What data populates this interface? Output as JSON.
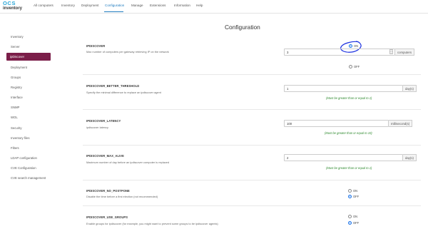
{
  "logo": {
    "line1": "OCS",
    "line2": "inventory"
  },
  "nav": {
    "all_computers": "All computers",
    "inventory": "Inventory",
    "deployment": "Deployment",
    "configuration": "Configuration",
    "manage": "Manage",
    "extensions": "Extensions",
    "information": "Information",
    "help": "Help"
  },
  "page": {
    "title": "Configuration"
  },
  "sidebar": {
    "items": [
      {
        "label": "Inventory"
      },
      {
        "label": "Server"
      },
      {
        "label": "ipDiscover"
      },
      {
        "label": "Deployment"
      },
      {
        "label": "Groups"
      },
      {
        "label": "Registry"
      },
      {
        "label": "Interface"
      },
      {
        "label": "SNMP"
      },
      {
        "label": "WOL"
      },
      {
        "label": "Security"
      },
      {
        "label": "Inventory files"
      },
      {
        "label": "Filters"
      },
      {
        "label": "LDAP configuration"
      },
      {
        "label": "CVE Configuration"
      },
      {
        "label": "CVE search management"
      }
    ]
  },
  "settings": {
    "ipdiscover": {
      "name": "IPDISCOVER",
      "desc": "Max number of computers per gateway retrieving IP on the network",
      "on_label": "ON",
      "off_label": "OFF",
      "value": "3",
      "unit": "computers",
      "selected": "ON"
    },
    "better_threshold": {
      "name": "IPDISCOVER_BETTER_THRESHOLD",
      "desc": "Specify the minimal difference to replace an ipdiscover agent",
      "value": "1",
      "unit": "day(s)",
      "hint": "(Must be greater than or equal to 1)"
    },
    "latency": {
      "name": "IPDISCOVER_LATENCY",
      "desc": "ipdiscover latency",
      "value": "100",
      "unit": "millisecond(s)",
      "hint": "(Must be greater than or equal to 10)"
    },
    "max_alive": {
      "name": "IPDISCOVER_MAX_ALIVE",
      "desc": "Maximum number of day before an ipdiscover computer is replaced",
      "value": "2",
      "unit": "day(s)",
      "hint": "(Must be greater than or equal to 1)"
    },
    "no_postpone": {
      "name": "IPDISCOVER_NO_POSTPONE",
      "desc": "Disable the time before a first election (not recommended)",
      "on_label": "ON",
      "off_label": "OFF",
      "selected": "OFF"
    },
    "use_groups": {
      "name": "IPDISCOVER_USE_GROUPS",
      "desc": "Enable groups for ipdiscover (for example, you might want to prevent some groups to be ipdiscover agents)",
      "on_label": "ON",
      "off_label": "OFF",
      "selected": "OFF"
    }
  },
  "colors": {
    "accent": "#1e7bbf",
    "sidebar_active": "#7b1e49",
    "hint_green": "#2f8a2f",
    "radio_selected": "#1a73e8",
    "annotation": "#1a2fe0"
  },
  "icons": [
    "spinner-icon",
    "radio-icon",
    "annotation-circle"
  ]
}
